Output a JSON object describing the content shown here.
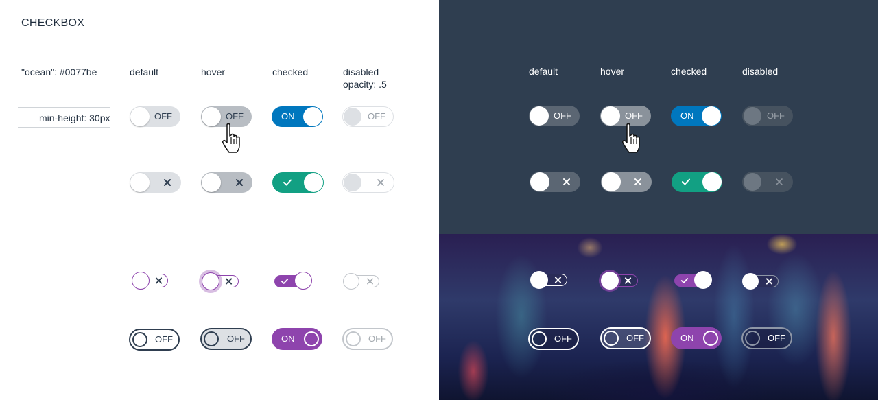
{
  "title": "CHECKBOX",
  "spec": {
    "color_name": "\"ocean\": #0077be",
    "min_height": "min-height: 30px"
  },
  "columns": {
    "default": "default",
    "hover": "hover",
    "checked": "checked",
    "disabled": "disabled",
    "disabled_note": "opacity: .5"
  },
  "labels": {
    "off": "OFF",
    "on": "ON"
  },
  "colors": {
    "ocean": "#0077be",
    "green": "#12a083",
    "purple": "#8e44ad",
    "navy": "#2f3e50",
    "light_track": "#dde0e4",
    "hover_track": "#b8bdc3"
  },
  "icons": {
    "x": "close-icon",
    "check": "check-icon",
    "cursor": "hand-pointer-icon"
  }
}
